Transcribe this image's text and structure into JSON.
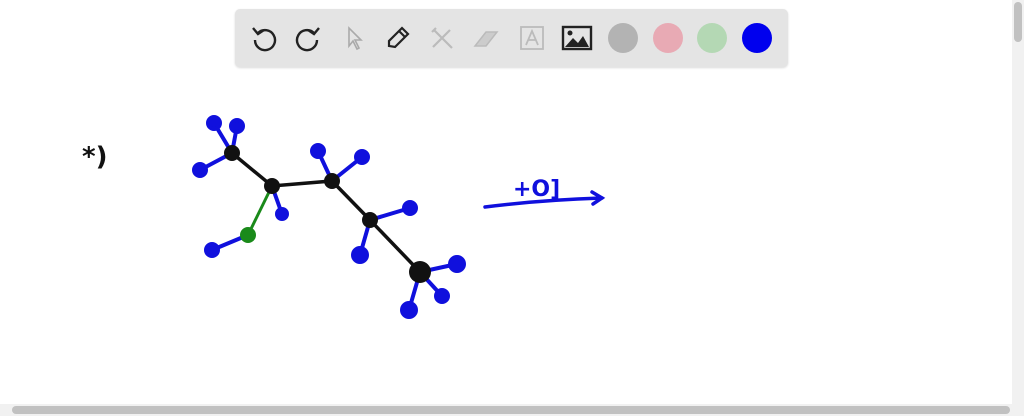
{
  "toolbar": {
    "tools": [
      "undo",
      "redo",
      "select",
      "pen",
      "tools",
      "eraser",
      "text",
      "image"
    ],
    "colors": [
      "#b3b3b3",
      "#e8aab4",
      "#b4d8b4",
      "#0000ee"
    ],
    "active_color": "#0000ee"
  },
  "drawing": {
    "label": "*)",
    "arrow_label": "+O]",
    "colors": {
      "carbon": "#111111",
      "hydrogen": "#1010dd",
      "oxygen": "#1a8a1a",
      "pink": "#cc2266"
    }
  }
}
